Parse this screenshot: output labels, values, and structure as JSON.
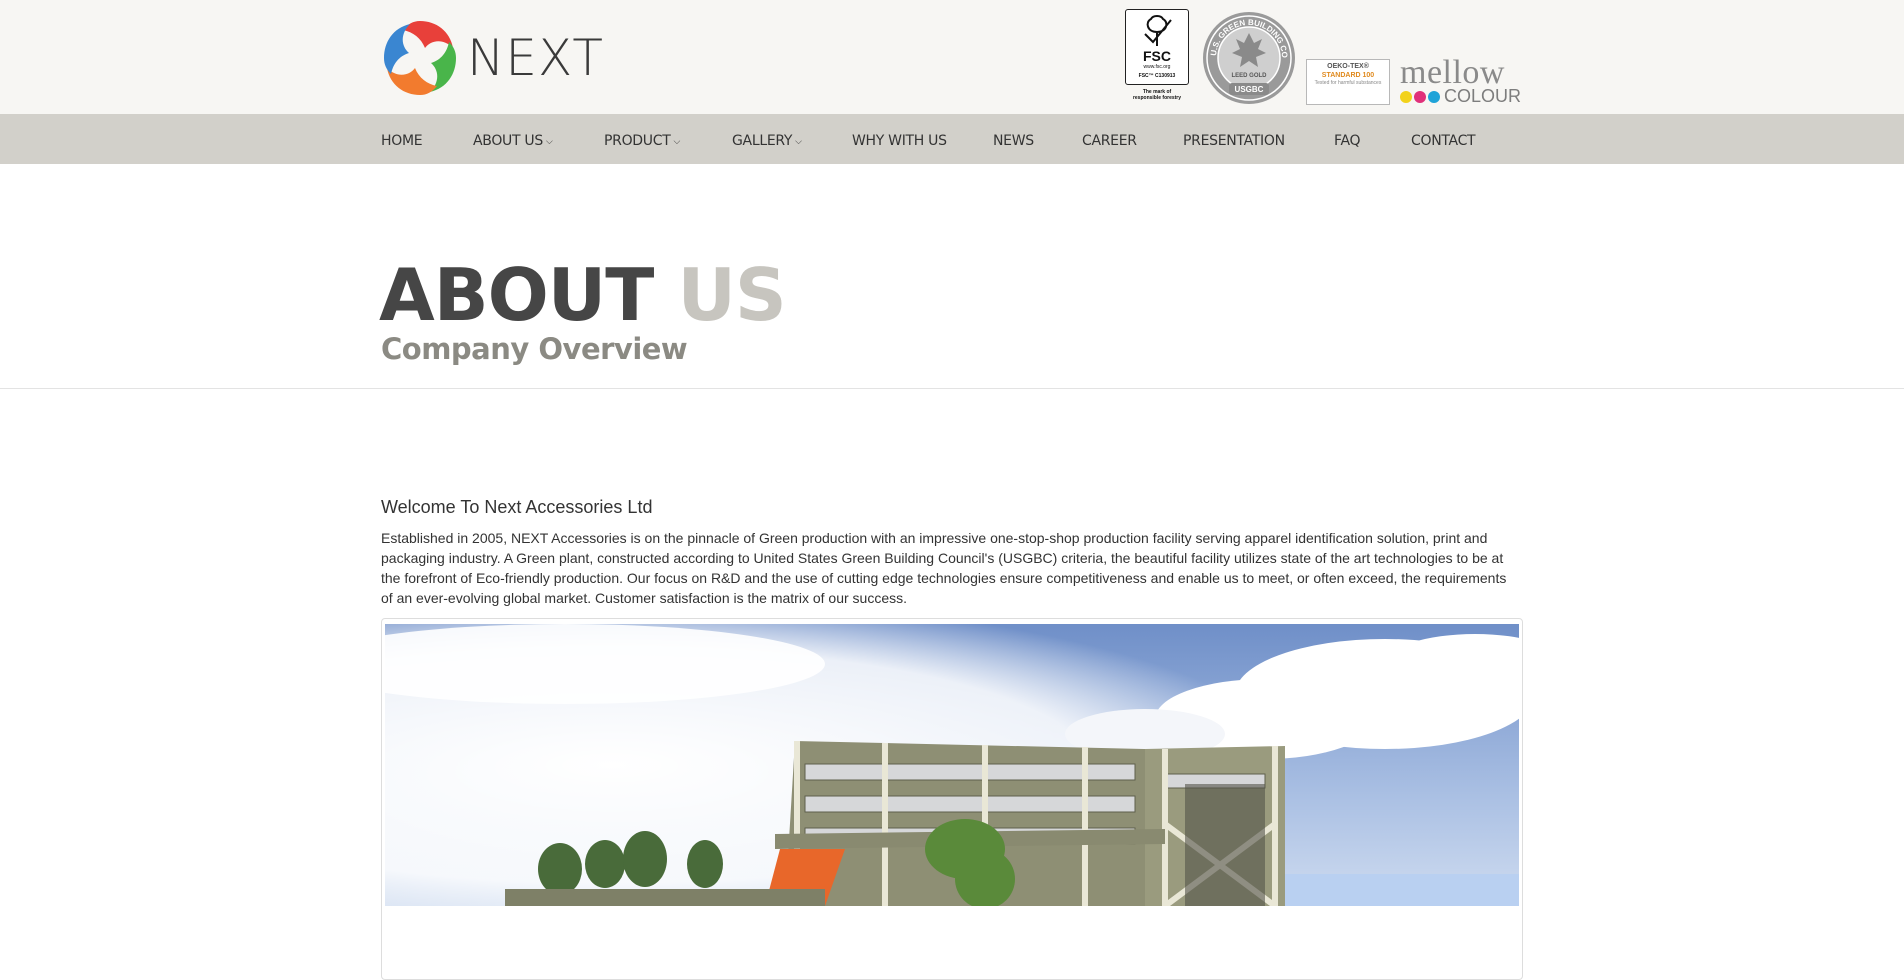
{
  "header": {
    "logo_text": "NEXT",
    "certifications": {
      "fsc": {
        "label": "FSC",
        "url": "www.fsc.org",
        "code": "FSC™ C130913",
        "mark_line1": "The mark of",
        "mark_line2": "responsible forestry"
      },
      "usgbc": {
        "ring_text": "U.S. GREEN BUILDING COUNCIL",
        "level": "LEED GOLD",
        "badge": "USGBC"
      },
      "oeko_tex": {
        "line1": "OEKO-TEX®",
        "line2": "STANDARD 100",
        "line3": "Tested for harmful substances"
      },
      "mellow": {
        "line1": "mellow",
        "line2": "COLOUR"
      }
    }
  },
  "nav": {
    "items": [
      {
        "label": "HOME"
      },
      {
        "label": "ABOUT US",
        "caret": "⌵"
      },
      {
        "label": "PRODUCT",
        "caret": "⌵"
      },
      {
        "label": "GALLERY",
        "caret": "⌵"
      },
      {
        "label": "WHY WITH US"
      },
      {
        "label": "NEWS"
      },
      {
        "label": "CAREER"
      },
      {
        "label": "PRESENTATION"
      },
      {
        "label": "FAQ"
      },
      {
        "label": "CONTACT"
      }
    ]
  },
  "page": {
    "title_part1": "ABOUT",
    "title_part2": "US",
    "subtitle": "Company Overview"
  },
  "content": {
    "welcome_heading": "Welcome To Next Accessories Ltd",
    "intro": "Established in 2005, NEXT Accessories is on the pinnacle of Green production with an impressive one-stop-shop production facility serving apparel identification solution, print and packaging industry. A Green plant, constructed according to United States Green Building Council's (USGBC) criteria, the beautiful facility utilizes state of the art technologies to be at the forefront of Eco-friendly production. Our focus on R&D and the use of cutting edge technologies ensure competitiveness and enable us to meet, or often exceed, the requirements of an ever-evolving global market. Customer satisfaction is the matrix of our success."
  },
  "colors": {
    "header_bg": "#f7f6f3",
    "nav_bg": "#d2d0ca",
    "title_dark": "#464646",
    "title_light": "#c7c5bf",
    "subtitle": "#8b8a83"
  }
}
